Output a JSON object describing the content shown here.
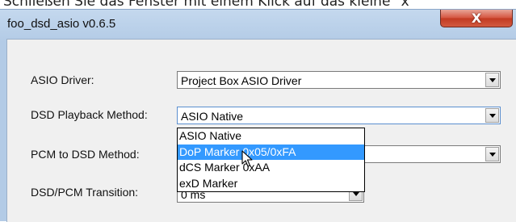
{
  "caption": "Schließen Sie das Fenster mit einem Klick auf das kleine \"x\"",
  "window": {
    "title": "foo_dsd_asio v0.6.5",
    "close_label": "X"
  },
  "form": {
    "asio_driver": {
      "label": "ASIO Driver:",
      "value": "Project Box ASIO Driver"
    },
    "dsd_playback": {
      "label": "DSD Playback Method:",
      "value": "ASIO Native"
    },
    "pcm_to_dsd": {
      "label": "PCM to DSD Method:"
    },
    "dsd_pcm_transition": {
      "label": "DSD/PCM Transition:",
      "value": "0 ms"
    }
  },
  "dropdown": {
    "options": [
      "ASIO Native",
      "DoP Marker 0x05/0xFA",
      "dCS Marker 0xAA",
      "exD Marker"
    ],
    "highlighted": "DoP Marker 0x05/0xFA"
  },
  "colors": {
    "selection": "#3399ff",
    "close_button": "#c8452c",
    "frame": "#b3cbe6"
  }
}
